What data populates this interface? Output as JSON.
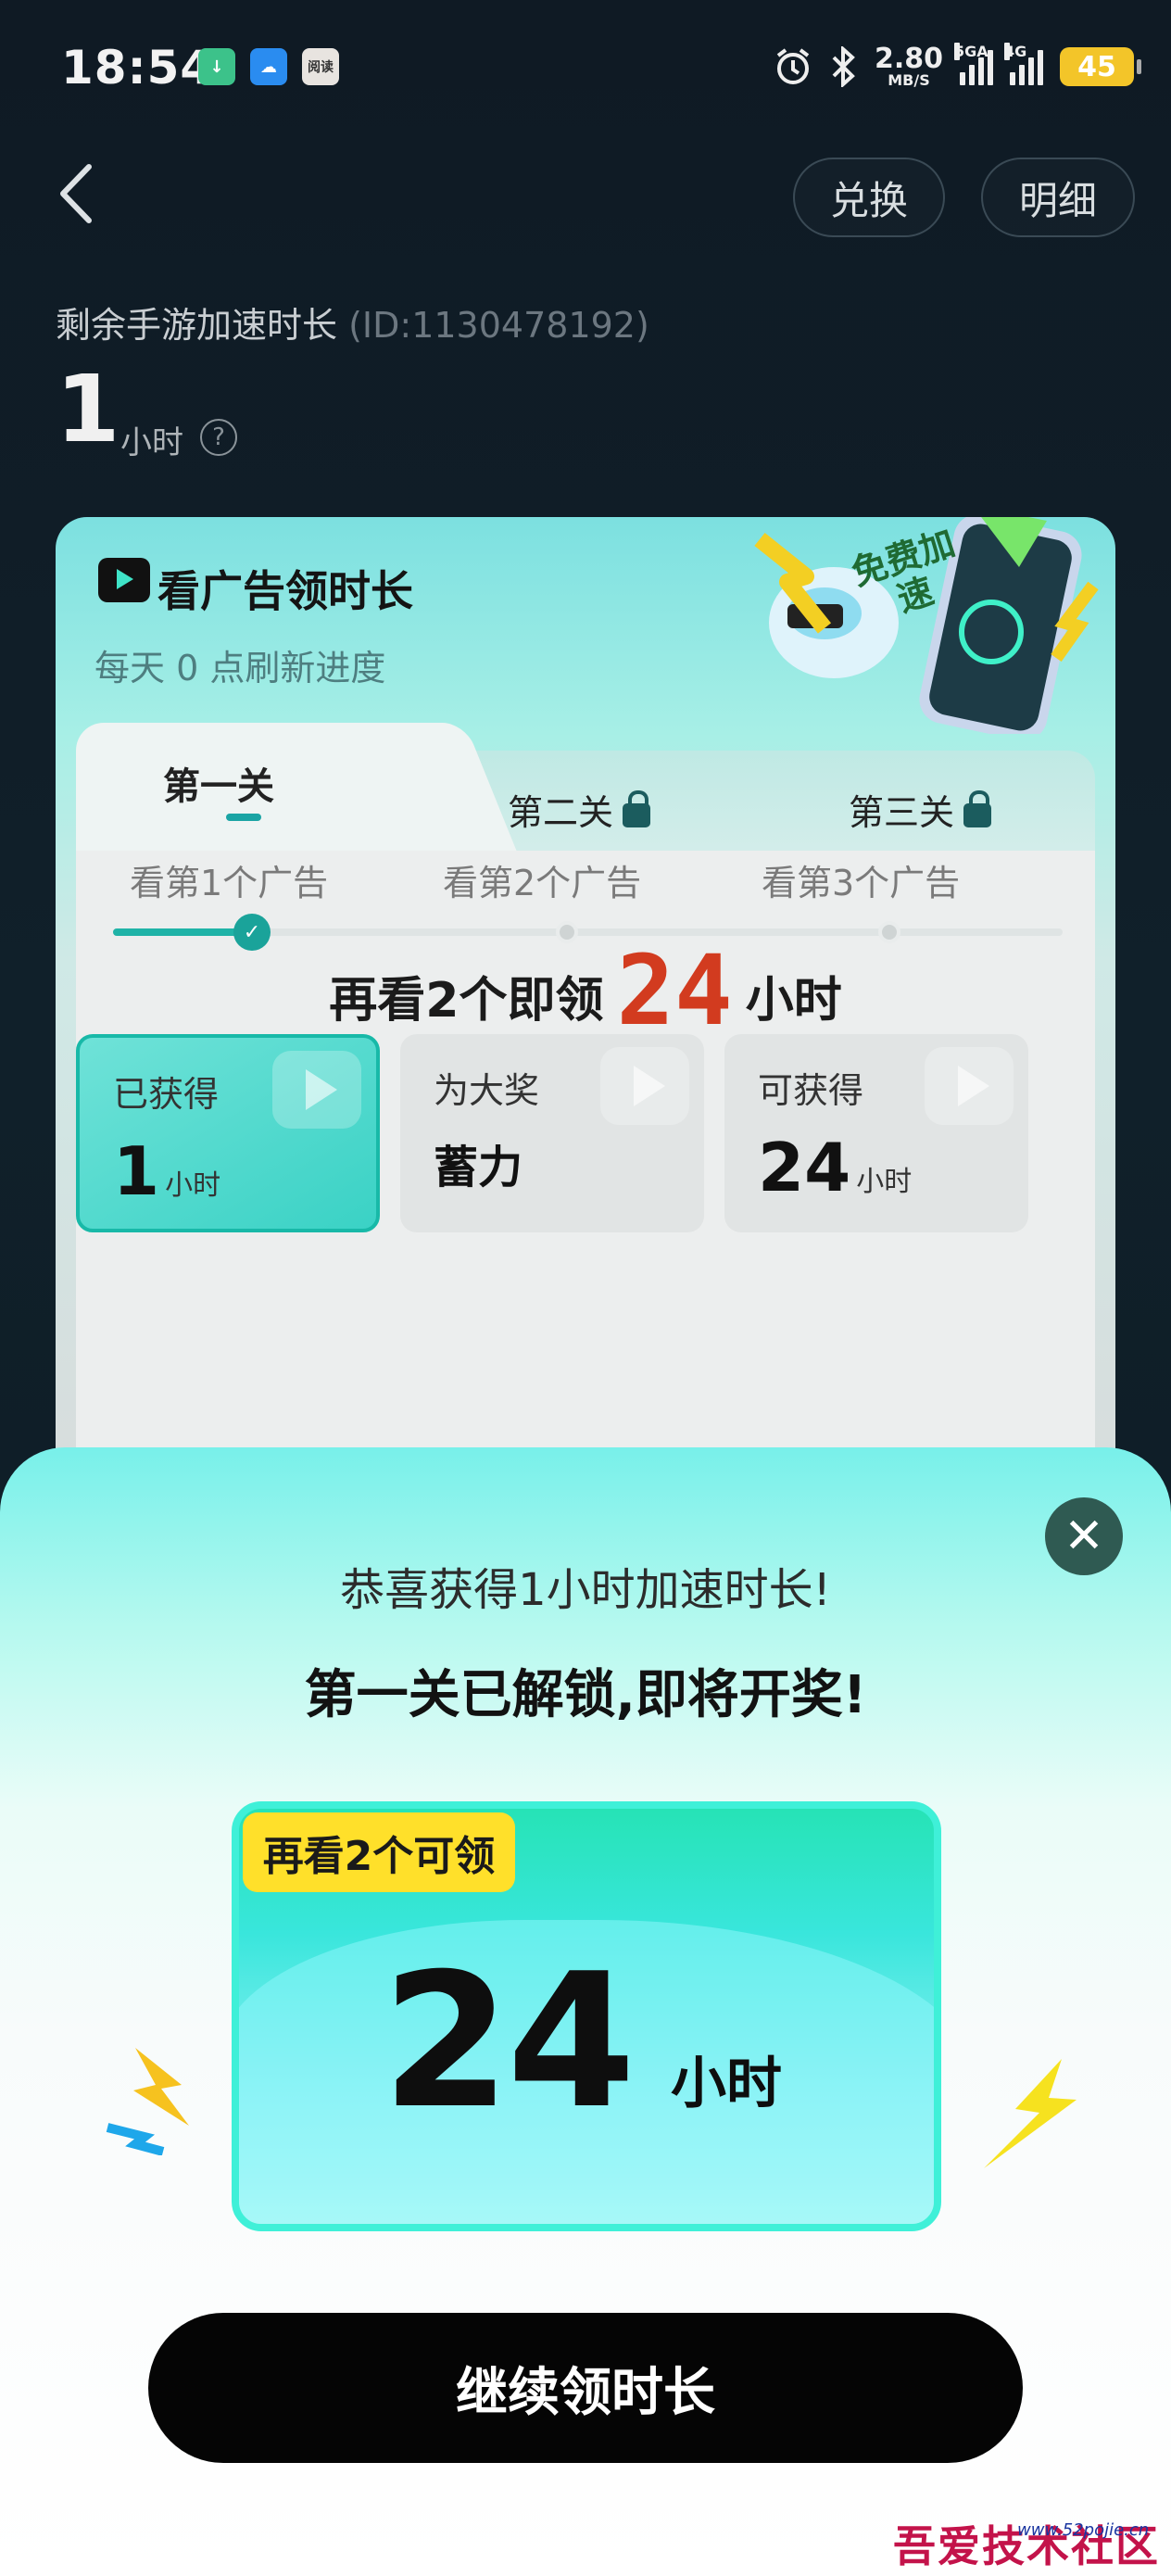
{
  "status_bar": {
    "time": "18:54",
    "app_icons": [
      {
        "name": "download-icon",
        "color": "#3cc28a",
        "glyph": "↓"
      },
      {
        "name": "cloud-icon",
        "color": "#2a8cf0",
        "glyph": "☁"
      },
      {
        "name": "reader-icon",
        "color": "#e8e4e0",
        "glyph": "阅读"
      }
    ],
    "speed_value": "2.80",
    "speed_unit": "MB/S",
    "sim1_label": "5GA",
    "sim2_label": "4G",
    "battery": "45",
    "battery_color": "#f3c529"
  },
  "header": {
    "exchange_label": "兑换",
    "detail_label": "明细"
  },
  "summary": {
    "label": "剩余手游加速时长",
    "id_text": "(ID:1130478192)",
    "hours": "1",
    "unit": "小时",
    "help": "?"
  },
  "card": {
    "title": "看广告领时长",
    "subtitle": "每天 0 点刷新进度",
    "badge_text": "免费加速",
    "tabs": [
      {
        "label": "第一关",
        "locked": false
      },
      {
        "label": "第二关",
        "locked": true
      },
      {
        "label": "第三关",
        "locked": true
      }
    ],
    "headline_prefix": "再看2个即领",
    "headline_number": "24",
    "headline_suffix": "小时",
    "steps": [
      "看第1个广告",
      "看第2个广告",
      "看第3个广告"
    ],
    "progress_fraction": 0.14,
    "boxes": [
      {
        "label": "已获得",
        "value": "1",
        "unit": "小时",
        "active": true
      },
      {
        "label": "为大奖",
        "value": "蓄力",
        "unit": "",
        "active": false
      },
      {
        "label": "可获得",
        "value": "24",
        "unit": "小时",
        "active": false
      }
    ]
  },
  "modal": {
    "close_glyph": "✕",
    "line1": "恭喜获得1小时加速时长!",
    "line2": "第一关已解锁,即将开奖!",
    "badge": "再看2个可领",
    "prize_number": "24",
    "prize_unit": "小时",
    "cta_label": "继续领时长",
    "accent": "#3ff0d8"
  },
  "watermark": {
    "text": "吾爱技术社区",
    "url": "www.52pojie.cn"
  }
}
